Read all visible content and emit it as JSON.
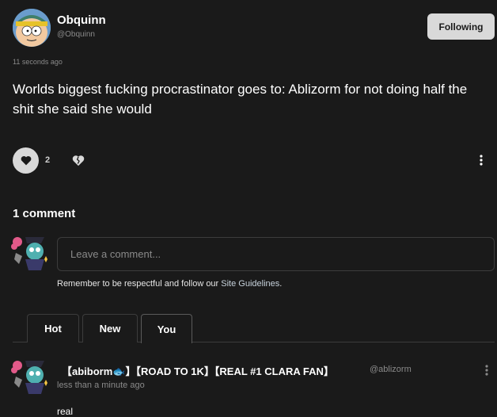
{
  "post": {
    "author_name": "Obquinn",
    "author_handle": "@Obquinn",
    "follow_label": "Following",
    "time": "11 seconds ago",
    "body": "Worlds biggest fucking procrastinator goes to: Ablizorm for not doing half the shit she said she would",
    "like_count": "2"
  },
  "comments": {
    "count_label": "1 comment",
    "input_placeholder": "Leave a comment...",
    "guidelines_prefix": "Remember to be respectful and follow our ",
    "guidelines_link": "Site Guidelines",
    "guidelines_suffix": ".",
    "tabs": [
      {
        "label": "Hot"
      },
      {
        "label": "New"
      },
      {
        "label": "You"
      }
    ],
    "items": [
      {
        "author_name": "【abiborm🐟】【ROAD TO 1K】【REAL #1 CLARA FAN】",
        "author_handle": "@ablizorm",
        "time": "less than a minute ago",
        "body": "real"
      }
    ]
  },
  "colors": {
    "background": "#1a1a1a",
    "button_light": "#d9d9d9",
    "muted_text": "#8a8a8a",
    "border": "#3c3c3c"
  },
  "icons": {
    "like": "heart-icon",
    "dislike": "broken-heart-icon",
    "menu": "kebab-menu-icon"
  }
}
